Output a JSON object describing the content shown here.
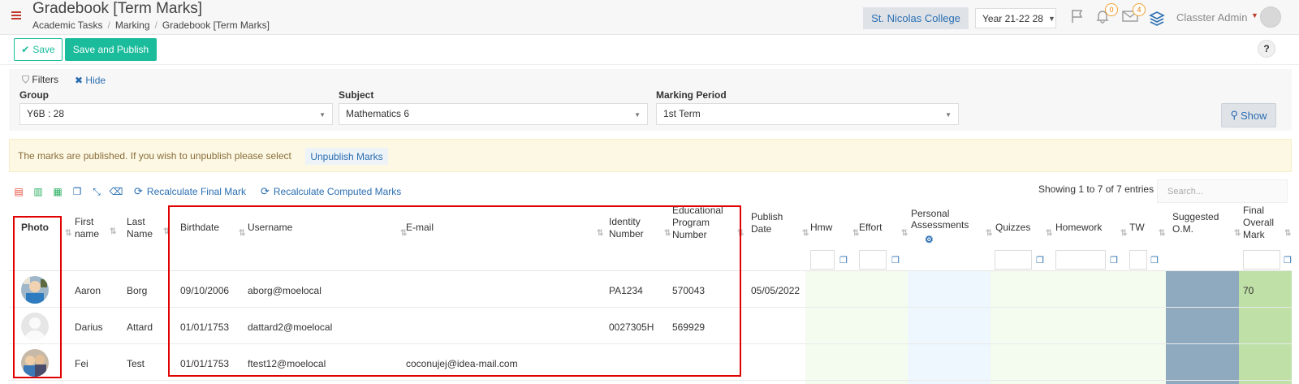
{
  "header": {
    "title": "Gradebook [Term Marks]",
    "breadcrumb": [
      "Academic Tasks",
      "Marking",
      "Gradebook [Term Marks]"
    ],
    "college": "St. Nicolas College",
    "year": "Year 21-22 28",
    "notifications_count": "0",
    "messages_count": "4",
    "user": "Classter Admin"
  },
  "toolbar": {
    "save_label": "Save",
    "publish_label": "Save and Publish",
    "help_label": "?"
  },
  "filters": {
    "label": "Filters",
    "hide_label": "Hide",
    "group_label": "Group",
    "group_value": "Y6B : 28",
    "subject_label": "Subject",
    "subject_value": "Mathematics 6",
    "period_label": "Marking Period",
    "period_value": "1st Term",
    "show_label": "Show"
  },
  "alert": {
    "text": "The marks are published. If you wish to unpublish please select",
    "button": "Unpublish Marks"
  },
  "tools": {
    "recalc_final": "Recalculate Final Mark",
    "recalc_computed": "Recalculate Computed Marks",
    "entries": "Showing 1 to 7 of 7 entries",
    "search_placeholder": "Search..."
  },
  "table": {
    "columns": {
      "photo": "Photo",
      "first_name": "First name",
      "last_name": "Last Name",
      "birthdate": "Birthdate",
      "username": "Username",
      "email": "E-mail",
      "identity": "Identity Number",
      "edu_program": "Educational Program Number",
      "publish_date": "Publish Date",
      "hmw": "Hmw",
      "effort": "Effort",
      "personal": "Personal Assessments",
      "quizzes": "Quizzes",
      "homework": "Homework",
      "tw": "TW",
      "suggested": "Suggested O.M.",
      "final": "Final Overall Mark"
    },
    "rows": [
      {
        "first": "Aaron",
        "last": "Borg",
        "birthdate": "09/10/2006",
        "username": "aborg@moelocal",
        "email": "",
        "identity": "PA1234",
        "edu": "570043",
        "publish": "05/05/2022",
        "final": "70"
      },
      {
        "first": "Darius",
        "last": "Attard",
        "birthdate": "01/01/1753",
        "username": "dattard2@moelocal",
        "email": "",
        "identity": "0027305H",
        "edu": "569929",
        "publish": "",
        "final": ""
      },
      {
        "first": "Fei",
        "last": "Test",
        "birthdate": "01/01/1753",
        "username": "ftest12@moelocal",
        "email": "coconujej@idea-mail.com",
        "identity": "",
        "edu": "",
        "publish": "",
        "final": ""
      }
    ]
  },
  "colors": {
    "accent": "#1abc9c",
    "link": "#2a6eb1",
    "highlight": "#e00000",
    "green_col": "#f4fbef",
    "blue_col": "#eef7fd",
    "suggested_col": "#8faabf",
    "final_col": "#bfe0a6"
  }
}
